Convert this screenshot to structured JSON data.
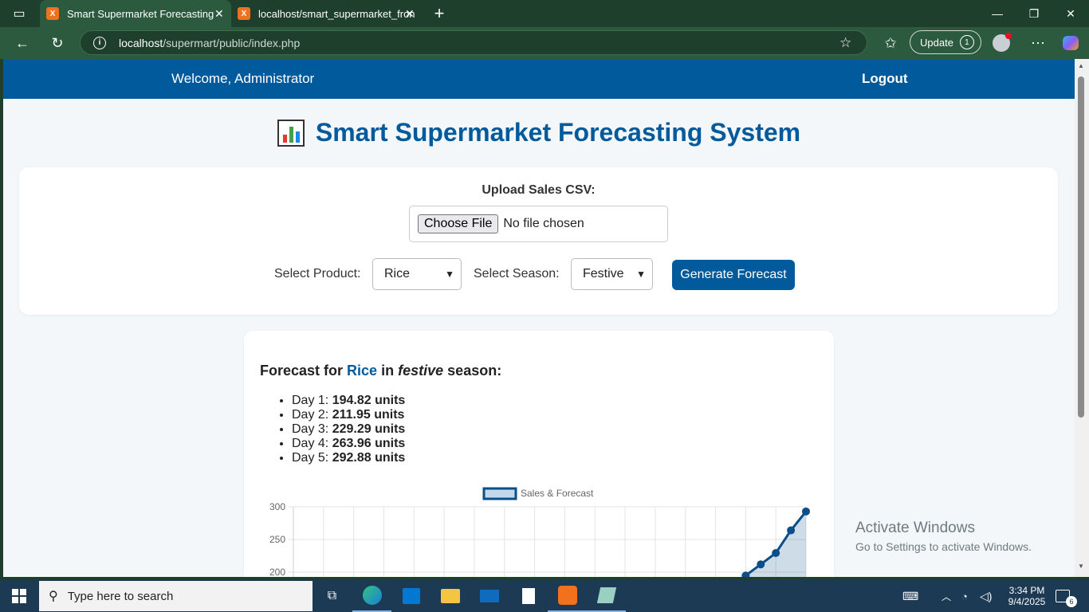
{
  "browser": {
    "tabs": [
      {
        "label": "Smart Supermarket Forecasting",
        "icon_text": "X"
      },
      {
        "label": "localhost/smart_supermarket_fron",
        "icon_text": "X"
      }
    ],
    "new_tab_icon": "+",
    "url_host": "localhost",
    "url_path": "/supermart/public/index.php",
    "update_label": "Update",
    "update_badge": "1"
  },
  "header": {
    "welcome": "Welcome, Administrator",
    "logout": "Logout"
  },
  "title": "Smart Supermarket Forecasting System",
  "upload": {
    "label": "Upload Sales CSV:",
    "choose_file": "Choose File",
    "no_file": "No file chosen"
  },
  "controls": {
    "product_label": "Select Product:",
    "product_value": "Rice",
    "season_label": "Select Season:",
    "season_value": "Festive",
    "generate": "Generate Forecast"
  },
  "forecast": {
    "prefix": "Forecast for",
    "product": "Rice",
    "mid": "in",
    "season": "festive",
    "suffix": "season:",
    "items": [
      {
        "day": "Day 1:",
        "value": "194.82 units"
      },
      {
        "day": "Day 2:",
        "value": "211.95 units"
      },
      {
        "day": "Day 3:",
        "value": "229.29 units"
      },
      {
        "day": "Day 4:",
        "value": "263.96 units"
      },
      {
        "day": "Day 5:",
        "value": "292.88 units"
      }
    ]
  },
  "chart_data": {
    "type": "line",
    "legend": "Sales & Forecast",
    "y_ticks": [
      "300",
      "250",
      "200"
    ],
    "ylim": [
      200,
      300
    ],
    "fill": true,
    "grid": true,
    "series": [
      {
        "name": "Sales & Forecast",
        "values": [
          194.82,
          211.95,
          229.29,
          263.96,
          292.88
        ]
      }
    ],
    "color": "#0a4f8a"
  },
  "watermark": {
    "line1": "Activate Windows",
    "line2": "Go to Settings to activate Windows."
  },
  "taskbar": {
    "search_placeholder": "Type here to search",
    "time": "3:34 PM",
    "date": "9/4/2025",
    "notif_count": "6"
  }
}
